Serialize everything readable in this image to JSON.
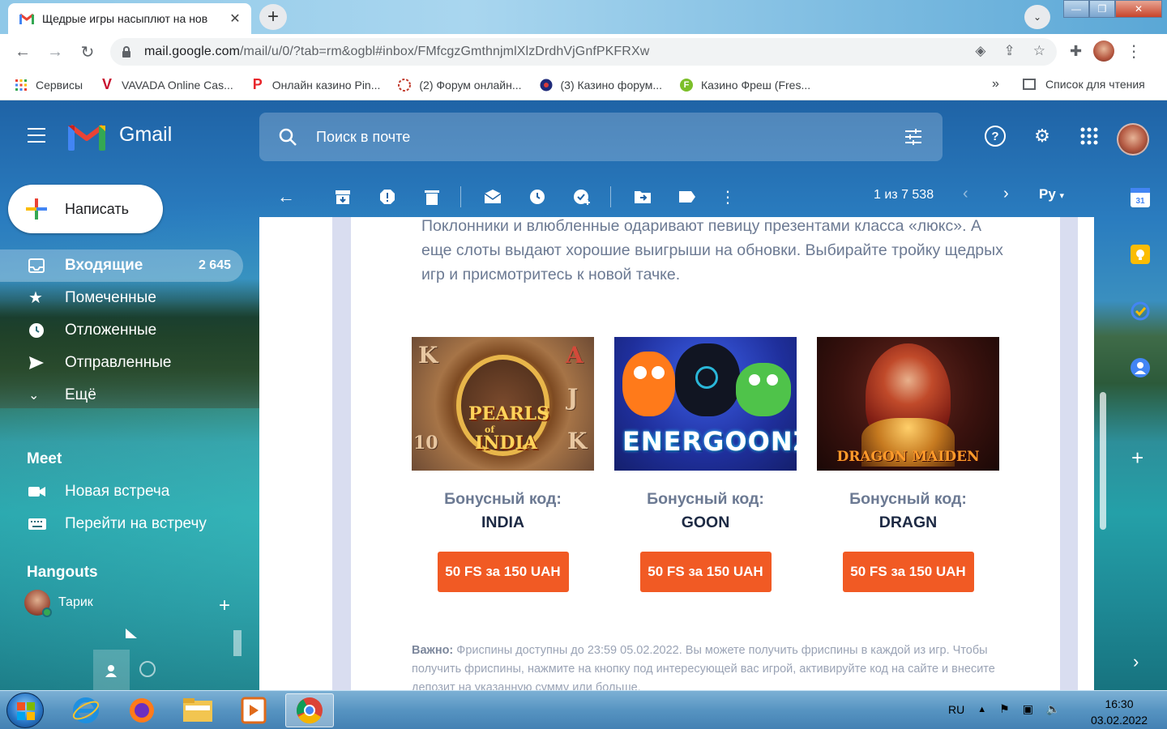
{
  "browser": {
    "tab_title": "Щедрые игры насыплют на нов",
    "tab_close": "✕",
    "url_host": "mail.google.com",
    "url_path": "/mail/u/0/?tab=rm&ogbl#inbox/FMfcgzGmthnjmlXlzDrdhVjGnfPKFRXw",
    "bookmarks": [
      {
        "label": "Сервисы",
        "icon": "apps-grid-icon"
      },
      {
        "label": "VAVADA Online Cas...",
        "icon": "vavada-icon"
      },
      {
        "label": "Онлайн казино Pin...",
        "icon": "pin-up-icon"
      },
      {
        "label": "(2) Форум онлайн...",
        "icon": "forum-icon"
      },
      {
        "label": "(3) Казино форум...",
        "icon": "casino-forum-icon"
      },
      {
        "label": "Казино Фреш (Fres...",
        "icon": "fresh-icon"
      }
    ],
    "bookmarks_more": "»",
    "reading_list": "Список для чтения"
  },
  "gmail": {
    "app_name": "Gmail",
    "search_placeholder": "Поиск в почте",
    "compose_label": "Написать",
    "nav": [
      {
        "label": "Входящие",
        "count": "2 645",
        "icon": "inbox-icon",
        "active": true
      },
      {
        "label": "Помеченные",
        "count": "",
        "icon": "star-icon"
      },
      {
        "label": "Отложенные",
        "count": "",
        "icon": "clock-icon"
      },
      {
        "label": "Отправленные",
        "count": "",
        "icon": "send-icon"
      },
      {
        "label": "Ещё",
        "count": "",
        "icon": "chevron-down-icon"
      }
    ],
    "meet_title": "Meet",
    "meet_items": [
      {
        "label": "Новая встреча",
        "icon": "video-camera-icon"
      },
      {
        "label": "Перейти на встречу",
        "icon": "keyboard-icon"
      }
    ],
    "hangouts_title": "Hangouts",
    "hangouts_user": "Тарик",
    "pager": "1 из 7 538",
    "input_lang": "Ру"
  },
  "email": {
    "paragraph": "Поклонники и влюбленные одаривают певицу презентами класса «люкс». А еще слоты выдают хорошие выигрыши на обновки. Выбирайте тройку щедрых игр и присмотритесь к новой тачке.",
    "games": [
      {
        "name": "Pearls of India",
        "art_line1": "PEARLS",
        "art_of": "of",
        "art_line2": "INDIA",
        "code_label": "Бонусный код:",
        "code": "INDIA",
        "button": "50 FS за 150 UAH"
      },
      {
        "name": "Energoonz",
        "art_text": "ENERGOONZ",
        "code_label": "Бонусный код:",
        "code": "GOON",
        "button": "50 FS за 150 UAH"
      },
      {
        "name": "Dragon Maiden",
        "art_text": "DRAGON MAIDEN",
        "code_label": "Бонусный код:",
        "code": "DRAGN",
        "button": "50 FS за 150 UAH"
      }
    ],
    "note_strong": "Важно:",
    "note_text": "Фриспины доступны до 23:59 05.02.2022. Вы можете получить фриспины в каждой из игр. Чтобы получить фриспины, нажмите на кнопку под интересующей вас игрой, активируйте код на сайте и внесите депозит на указанную сумму или больше."
  },
  "taskbar": {
    "lang": "RU",
    "time": "16:30",
    "date": "03.02.2022"
  },
  "colors": {
    "cta": "#f15a24",
    "text_muted": "#6c7a93",
    "code_text": "#1d2a44"
  }
}
